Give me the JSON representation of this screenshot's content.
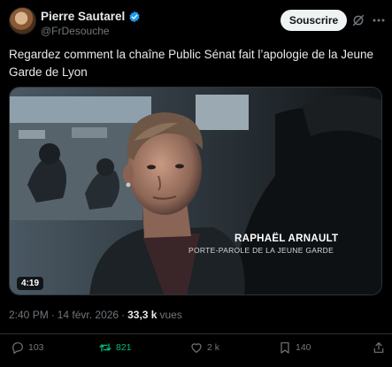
{
  "author": {
    "display_name": "Pierre Sautarel",
    "handle": "@FrDesouche",
    "verified": true
  },
  "header": {
    "follow_label": "Souscrire"
  },
  "tweet": {
    "text": "Regardez comment la chaîne Public Sénat fait l’apologie de la Jeune Garde de Lyon"
  },
  "media": {
    "caption_name": "RAPHAËL ARNAULT",
    "caption_role": "PORTE-PAROLE DE LA JEUNE GARDE",
    "duration": "4:19"
  },
  "meta": {
    "time": "2:40 PM",
    "separator": "·",
    "date": "14 févr. 2026",
    "views_count": "33,3 k",
    "views_label": "vues"
  },
  "actions": {
    "replies": "103",
    "reposts": "821",
    "likes": "2 k",
    "views": "140"
  },
  "colors": {
    "repost_green": "#00ba7c",
    "verified_blue": "#1d9bf0",
    "muted": "#71767b"
  }
}
